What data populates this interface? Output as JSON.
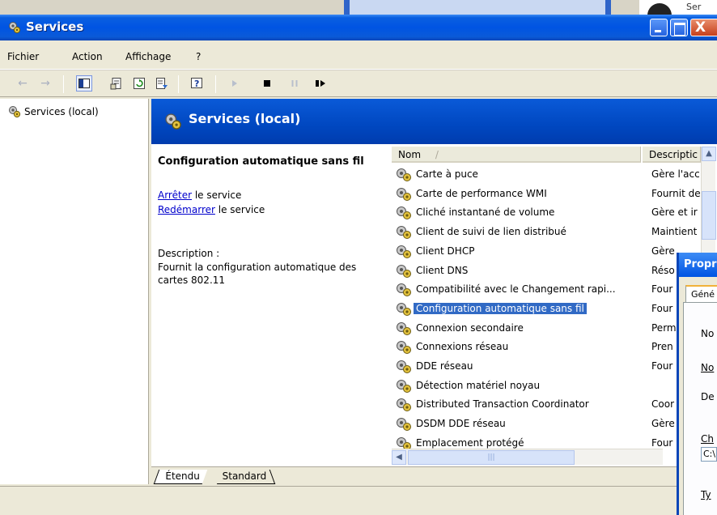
{
  "background": {
    "behind_text": "Ser"
  },
  "window": {
    "title": "Services",
    "controls": {
      "close_glyph": "X"
    }
  },
  "menu": [
    {
      "label": "Fichier"
    },
    {
      "label": "Action"
    },
    {
      "label": "Affichage"
    },
    {
      "label": "?"
    }
  ],
  "toolbar": {
    "buttons": [
      "back-icon",
      "forward-icon",
      "show-hide-tree-icon",
      "properties-icon",
      "refresh-icon",
      "export-list-icon",
      "help-icon",
      "start-service-icon",
      "stop-service-icon",
      "pause-service-icon",
      "restart-service-icon"
    ]
  },
  "tree": {
    "root": "Services (local)"
  },
  "header": {
    "title": "Services (local)"
  },
  "details": {
    "service_name": "Configuration automatique sans fil",
    "stop_link": "Arrêter",
    "stop_suffix": " le service",
    "restart_link": "Redémarrer",
    "restart_suffix": " le service",
    "description_label": "Description :",
    "description_text": "Fournit la configuration automatique des cartes 802.11"
  },
  "list": {
    "columns": [
      {
        "label": "Nom",
        "sort": "ascending"
      },
      {
        "label": "Descriptic"
      }
    ],
    "rows": [
      {
        "name": "Carte à puce",
        "description": "Gère l'acc"
      },
      {
        "name": "Carte de performance WMI",
        "description": "Fournit de"
      },
      {
        "name": "Cliché instantané de volume",
        "description": "Gère et ir"
      },
      {
        "name": "Client de suivi de lien distribué",
        "description": "Maintient"
      },
      {
        "name": "Client DHCP",
        "description": "Gère"
      },
      {
        "name": "Client DNS",
        "description": "Réso"
      },
      {
        "name": "Compatibilité avec le Changement rapi...",
        "description": "Four"
      },
      {
        "name": "Configuration automatique sans fil",
        "description": "Four",
        "selected": true
      },
      {
        "name": "Connexion secondaire",
        "description": "Perm"
      },
      {
        "name": "Connexions réseau",
        "description": "Pren"
      },
      {
        "name": "DDE réseau",
        "description": "Four"
      },
      {
        "name": "Détection matériel noyau",
        "description": ""
      },
      {
        "name": "Distributed Transaction Coordinator",
        "description": "Coor"
      },
      {
        "name": "DSDM DDE réseau",
        "description": "Gère"
      },
      {
        "name": "Emplacement protégé",
        "description": "Four"
      }
    ]
  },
  "tabs": [
    {
      "label": "Étendu",
      "active": true
    },
    {
      "label": "Standard",
      "active": false
    }
  ],
  "dialog": {
    "title": "Propr",
    "tab": "Géné",
    "labels": [
      "No",
      "No",
      "De",
      "Ch",
      "Ty"
    ],
    "path_value": "C:\\"
  },
  "colors": {
    "titlebar": "#0054e3",
    "selection": "#316ac5",
    "link": "#0000cc",
    "header_band": "#0047c0"
  }
}
